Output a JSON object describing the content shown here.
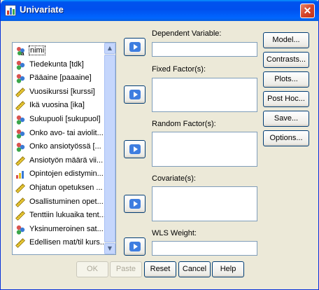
{
  "window": {
    "title": "Univariate",
    "close_glyph": "✕"
  },
  "variables": [
    {
      "label": "nimi",
      "icon": "string-nominal-icon",
      "selected": true
    },
    {
      "label": "Tiedekunta [tdk]",
      "icon": "nominal-icon"
    },
    {
      "label": "Pääaine [paaaine]",
      "icon": "nominal-icon"
    },
    {
      "label": "Vuosikurssi [kurssi]",
      "icon": "scale-icon"
    },
    {
      "label": "Ikä vuosina [ika]",
      "icon": "scale-icon"
    },
    {
      "label": "Sukupuoli [sukupuol]",
      "icon": "nominal-icon"
    },
    {
      "label": "Onko avo- tai aviolit...",
      "icon": "nominal-icon"
    },
    {
      "label": "Onko ansiotyössä [...",
      "icon": "nominal-icon"
    },
    {
      "label": "Ansiotyön määrä vii...",
      "icon": "scale-icon"
    },
    {
      "label": "Opintojen edistymin...",
      "icon": "ordinal-icon"
    },
    {
      "label": "Ohjatun opetuksen ...",
      "icon": "scale-icon"
    },
    {
      "label": "Osallistuminen opet...",
      "icon": "scale-icon"
    },
    {
      "label": "Tenttiin lukuaika tent...",
      "icon": "scale-icon"
    },
    {
      "label": "Yksinumeroinen sat...",
      "icon": "nominal-icon"
    },
    {
      "label": "Edellisen mat/til kurs...",
      "icon": "scale-icon"
    }
  ],
  "fields": {
    "dependent": "Dependent Variable:",
    "fixed": "Fixed Factor(s):",
    "random": "Random Factor(s):",
    "covariate": "Covariate(s):",
    "wls": "WLS Weight:"
  },
  "side_buttons": [
    "Model...",
    "Contrasts...",
    "Plots...",
    "Post Hoc...",
    "Save...",
    "Options..."
  ],
  "bottom_buttons": {
    "ok": "OK",
    "paste": "Paste",
    "reset": "Reset",
    "cancel": "Cancel",
    "help": "Help"
  },
  "colors": {
    "titlebar": "#0054e3",
    "dialog": "#ece9d8",
    "nominal": "#d9534f",
    "scale": "#e8c21a",
    "ordinal": "#e06a2a"
  }
}
